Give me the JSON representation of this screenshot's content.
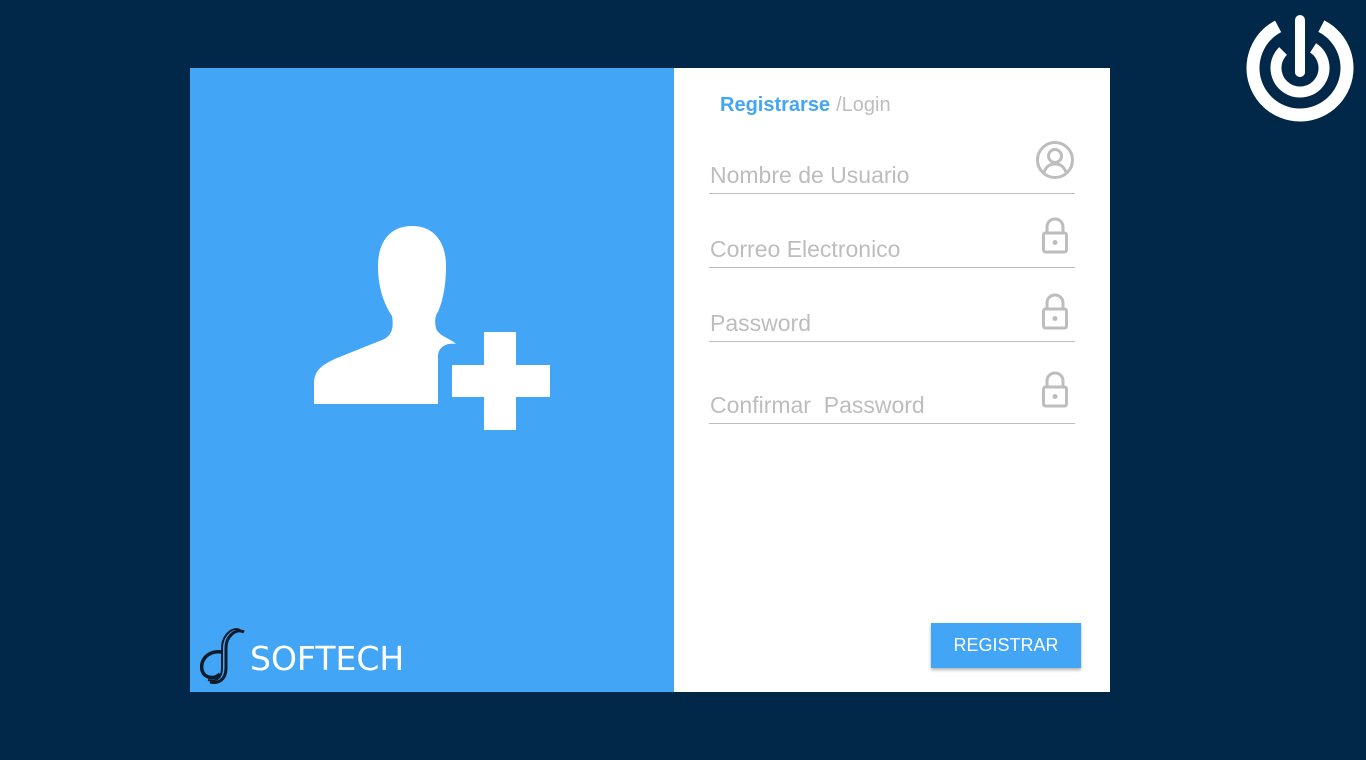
{
  "colors": {
    "background": "#022849",
    "accent": "#42a5f5",
    "panel": "#ffffff",
    "muted": "#bdbdbd"
  },
  "brand": {
    "name": "SOFTECH"
  },
  "tabs": {
    "active_label": "Registrarse",
    "separator": "/",
    "inactive_label": "Login"
  },
  "form": {
    "fields": [
      {
        "placeholder": "Nombre de Usuario",
        "value": "",
        "icon": "user-circle-icon"
      },
      {
        "placeholder": "Correo Electronico",
        "value": "",
        "icon": "lock-icon"
      },
      {
        "placeholder": "Password",
        "value": "",
        "icon": "lock-icon"
      },
      {
        "placeholder": "Confirmar  Password",
        "value": "",
        "icon": "lock-icon"
      }
    ],
    "submit_label": "REGISTRAR"
  },
  "icons": {
    "hero": "user-add-icon",
    "corner": "power-icon"
  }
}
